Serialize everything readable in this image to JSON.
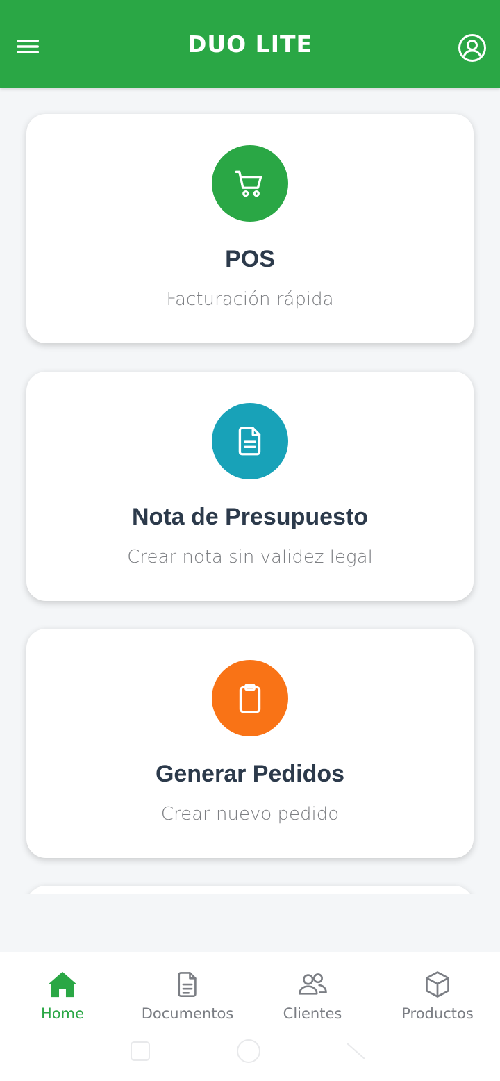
{
  "app": {
    "title": "DUO LITE"
  },
  "colors": {
    "primary": "#2aa745",
    "pos_icon_bg": "#2aa745",
    "nota_icon_bg": "#18a2b8",
    "pedidos_icon_bg": "#f97316",
    "title_text": "#2c3a4b",
    "subtitle_text": "#7d7f83"
  },
  "cards": [
    {
      "title": "POS",
      "subtitle": "Facturación rápida",
      "icon": "shopping-cart-icon"
    },
    {
      "title": "Nota de Presupuesto",
      "subtitle": "Crear nota sin validez legal",
      "icon": "document-icon"
    },
    {
      "title": "Generar Pedidos",
      "subtitle": "Crear nuevo pedido",
      "icon": "clipboard-icon"
    }
  ],
  "nav": {
    "items": [
      {
        "label": "Home",
        "icon": "home-icon",
        "active": true
      },
      {
        "label": "Documentos",
        "icon": "document-icon",
        "active": false
      },
      {
        "label": "Clientes",
        "icon": "users-icon",
        "active": false
      },
      {
        "label": "Productos",
        "icon": "box-icon",
        "active": false
      }
    ]
  }
}
